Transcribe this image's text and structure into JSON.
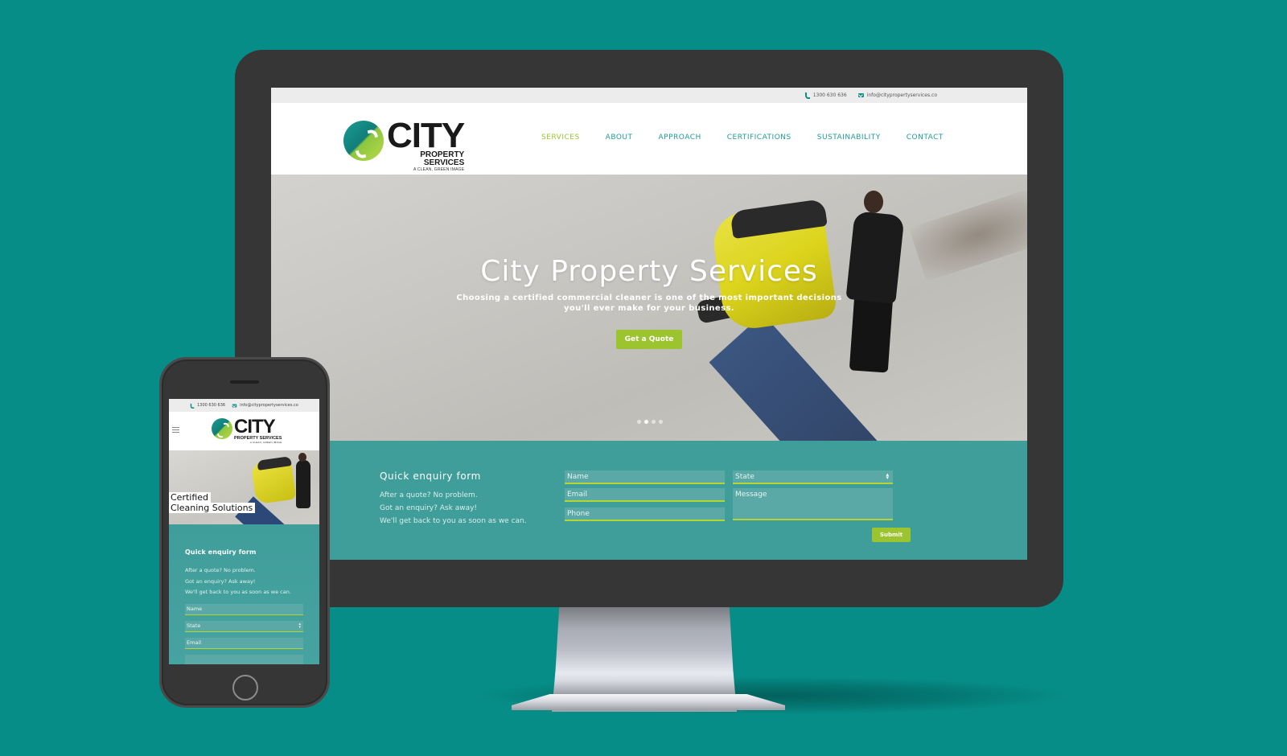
{
  "colors": {
    "background": "#068d87",
    "device_frame": "#363636",
    "brand_teal": "#1f9c96",
    "brand_green": "#9cc42e",
    "form_background": "#3f9d9a",
    "field_underline": "#b5d531"
  },
  "desktop": {
    "topbar": {
      "phone_icon": "phone-icon",
      "phone": "1300 630 636",
      "email_icon": "mail-icon",
      "email": "info@citypropertyservices.co"
    },
    "logo": {
      "mark_icon": "city-logo-mark",
      "name": "CITY",
      "subtitle": "PROPERTY SERVICES",
      "tagline": "A CLEAN, GREEN IMAGE"
    },
    "nav": {
      "items": [
        {
          "label": "SERVICES",
          "active": true
        },
        {
          "label": "ABOUT",
          "active": false
        },
        {
          "label": "APPROACH",
          "active": false
        },
        {
          "label": "CERTIFICATIONS",
          "active": false
        },
        {
          "label": "SUSTAINABILITY",
          "active": false
        },
        {
          "label": "CONTACT",
          "active": false
        }
      ]
    },
    "hero": {
      "title": "City Property Services",
      "subtitle": "Choosing a certified commercial cleaner is one of the most important decisions you'll ever make for your business.",
      "cta_label": "Get a Quote",
      "slides_total": 4,
      "active_slide": 2
    },
    "enquiry": {
      "title": "Quick enquiry form",
      "lines": [
        "After a quote? No problem.",
        "Got an enquiry? Ask away!",
        "We'll get back to you as soon as we can."
      ],
      "fields": {
        "name_placeholder": "Name",
        "email_placeholder": "Email",
        "phone_placeholder": "Phone",
        "state_selected": "State",
        "message_placeholder": "Message"
      },
      "submit_label": "Submit"
    }
  },
  "mobile": {
    "topbar": {
      "phone": "1300 630 636",
      "email": "info@citypropertyservices.co"
    },
    "menu_icon": "hamburger-menu-icon",
    "logo": {
      "name": "CITY",
      "subtitle": "PROPERTY SERVICES",
      "tagline": "A CLEAN, GREEN IMAGE"
    },
    "hero": {
      "caption_line1": "Certified",
      "caption_line2": "Cleaning Solutions"
    },
    "enquiry": {
      "title": "Quick enquiry form",
      "lines": [
        "After a quote? No problem.",
        "Got an enquiry? Ask away!",
        "We'll get back to you as soon as we can."
      ],
      "fields": {
        "name_placeholder": "Name",
        "state_selected": "State",
        "email_placeholder": "Email"
      }
    }
  }
}
